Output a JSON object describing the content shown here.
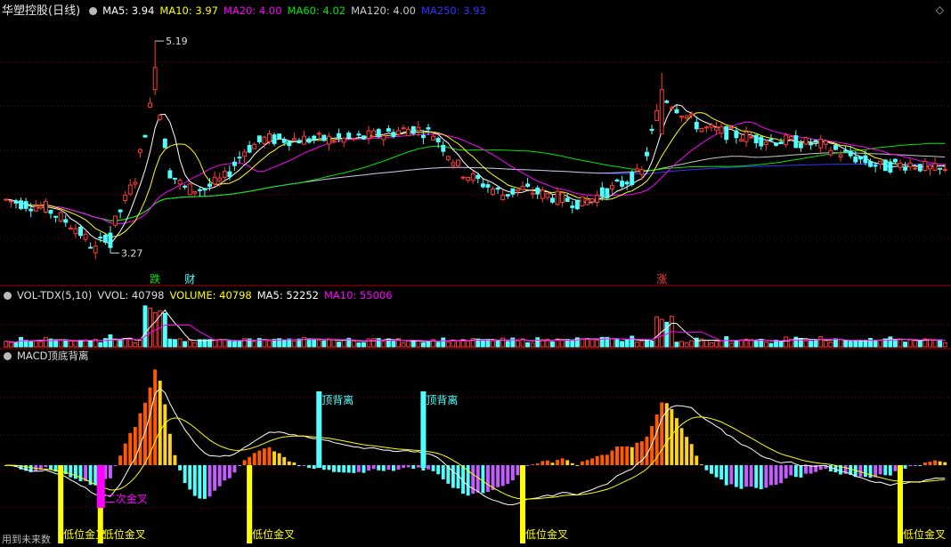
{
  "colors": {
    "up": "#ff3c3c",
    "down": "#52ffff",
    "ma5": "#ffffff",
    "ma10": "#ffff00",
    "ma20": "#ff00ff",
    "ma60": "#00e600",
    "ma120": "#c8c8c8",
    "ma250": "#3232ff",
    "vol_ma5": "#ffffff",
    "vol_ma10": "#ff00ff",
    "macd_pos_a": "#ff5a00",
    "macd_pos_b": "#ffd21e",
    "macd_neg_a": "#52ffff",
    "macd_neg_b": "#c45cff",
    "signal": "#ffff00",
    "grid": "#7a0000"
  },
  "header": {
    "stock_title": "华塑控股(日线)",
    "ma5": "MA5: 3.94",
    "ma10": "MA10: 3.97",
    "ma20": "MA20: 4.00",
    "ma60": "MA60: 4.02",
    "ma120": "MA120: 4.00",
    "ma250": "MA250: 3.93",
    "corner_right": "◇",
    "corner_left": "◇"
  },
  "volume_header": {
    "name": "VOL-TDX(5,10)",
    "vvol": "VVOL: 40798",
    "volume": "VOLUME: 40798",
    "ma5": "MA5: 52252",
    "ma10": "MA10: 55006"
  },
  "macd_header": {
    "name": "MACD顶底背离"
  },
  "footer": {
    "text": "用到未来数"
  },
  "chart_data": [
    {
      "type": "candlestick",
      "title": "华塑控股(日线)",
      "ylim": [
        3.0,
        5.4
      ],
      "price_annotations": {
        "high": "5.19",
        "low": "3.27"
      },
      "markers": [
        {
          "index": 30,
          "text": "跌",
          "color": "#00e600"
        },
        {
          "index": 37,
          "text": "财",
          "color": "#52ffff"
        },
        {
          "index": 132,
          "text": "涨",
          "color": "#ff3c3c"
        }
      ],
      "candles_count": 190
    },
    {
      "type": "bar",
      "title": "VOL-TDX(5,10)",
      "series": [
        {
          "name": "VOLUME"
        },
        {
          "name": "MA5"
        },
        {
          "name": "MA10"
        }
      ]
    },
    {
      "type": "bar",
      "title": "MACD顶底背离",
      "signals": [
        {
          "index": 11,
          "text": "低位金叉"
        },
        {
          "index": 19,
          "text": "低位金叉"
        },
        {
          "index": 19,
          "text": "二次金叉"
        },
        {
          "index": 49,
          "text": "低位金叉"
        },
        {
          "index": 104,
          "text": "低位金叉"
        },
        {
          "index": 180,
          "text": "低位金叉"
        }
      ],
      "divergence": [
        {
          "index": 63,
          "text": "顶背离"
        },
        {
          "index": 84,
          "text": "顶背离"
        }
      ]
    }
  ]
}
